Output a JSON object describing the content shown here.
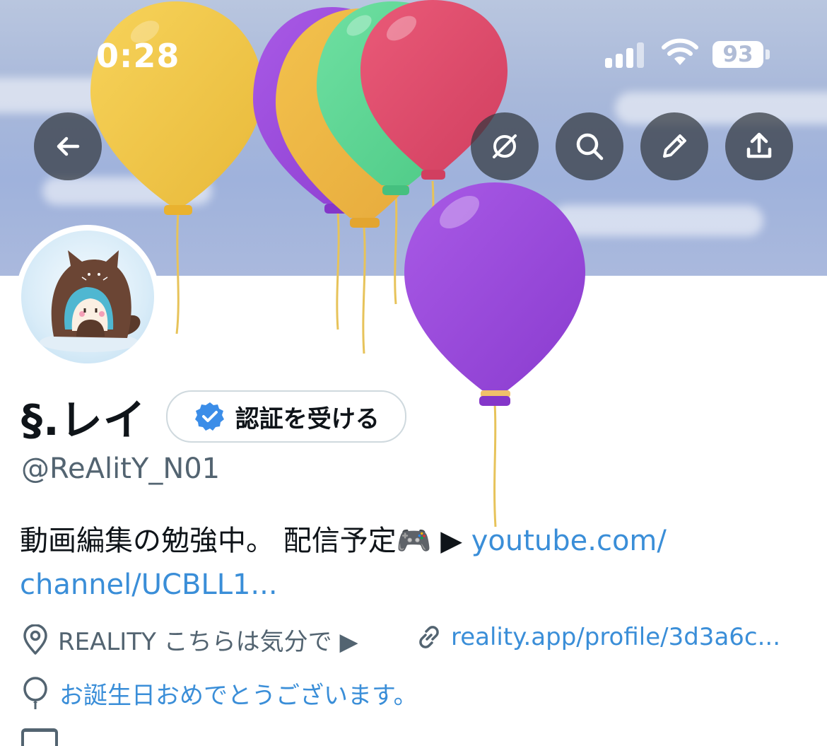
{
  "status_bar": {
    "time": "0:28",
    "battery": "93"
  },
  "nav": {
    "back_icon": "arrow-left-icon",
    "actions": [
      "mute-icon",
      "search-icon",
      "edit-icon",
      "share-icon"
    ]
  },
  "profile": {
    "display_name": "§.レイ",
    "verify_button": "認証を受ける",
    "handle": "@ReAlitY_N01",
    "bio_text": "動画編集の勉強中。 配信予定🎮 ▶︎ ",
    "bio_link_line1": "youtube.com/",
    "bio_link_line2": "channel/UCBLL1...",
    "location": "REALITY こちらは気分で ▶︎",
    "website": "reality.app/profile/3d3a6c...",
    "birthday_message": "お誕生日おめでとうございます。"
  },
  "colors": {
    "link": "#3a8ed8",
    "verified_badge": "#3b8de8",
    "balloon_yellow": "#f2c94c",
    "balloon_purple": "#9b4ddb",
    "balloon_green": "#5ed596",
    "balloon_red": "#e0506e"
  }
}
